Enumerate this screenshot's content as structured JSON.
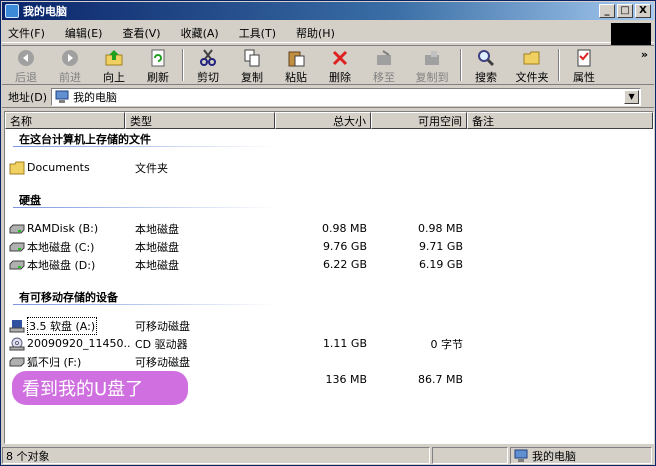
{
  "window": {
    "title": "我的电脑"
  },
  "title_buttons": {
    "minimize": "_",
    "maximize": "□",
    "close": "X"
  },
  "menu": [
    "文件(F)",
    "编辑(E)",
    "查看(V)",
    "收藏(A)",
    "工具(T)",
    "帮助(H)"
  ],
  "toolbar": {
    "back": "后退",
    "forward": "前进",
    "up": "向上",
    "refresh": "刷新",
    "cut": "剪切",
    "copy": "复制",
    "paste": "粘贴",
    "delete": "删除",
    "move_to": "移至",
    "copy_to": "复制到",
    "search": "搜索",
    "folders": "文件夹",
    "properties": "属性",
    "more": "»"
  },
  "address": {
    "label": "地址(D)",
    "value": "我的电脑",
    "dropdown": "▼"
  },
  "columns": {
    "name": "名称",
    "type": "类型",
    "total": "总大小",
    "free": "可用空间",
    "notes": "备注"
  },
  "groups": {
    "files": "在这台计算机上存储的文件",
    "disks": "硬盘",
    "removable": "有可移动存储的设备"
  },
  "items": {
    "documents": {
      "name": "Documents",
      "type": "文件夹"
    },
    "ramdisk": {
      "name": "RAMDisk (B:)",
      "type": "本地磁盘",
      "total": "0.98 MB",
      "free": "0.98 MB"
    },
    "disk_c": {
      "name": "本地磁盘 (C:)",
      "type": "本地磁盘",
      "total": "9.76 GB",
      "free": "9.71 GB"
    },
    "disk_d": {
      "name": "本地磁盘 (D:)",
      "type": "本地磁盘",
      "total": "6.22 GB",
      "free": "6.19 GB"
    },
    "floppy": {
      "name": "3.5 软盘 (A:)",
      "type": "可移动磁盘"
    },
    "cd": {
      "name": "20090920_11450...",
      "type": "CD 驱动器",
      "total": "1.11 GB",
      "free": "0 字节"
    },
    "usb": {
      "name": "狐不归 (F:)",
      "type": "可移动磁盘"
    },
    "usb2": {
      "total": "136 MB",
      "free": "86.7 MB"
    }
  },
  "annotation": "看到我的U盘了",
  "status": {
    "count": "8 个对象",
    "location": "我的电脑"
  }
}
